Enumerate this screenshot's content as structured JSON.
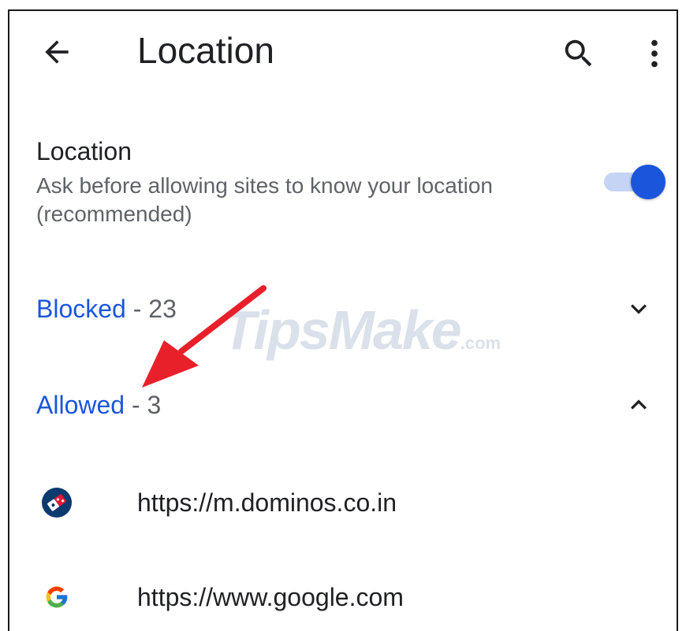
{
  "appbar": {
    "title": "Location",
    "back_icon": "arrow-left-icon",
    "search_icon": "search-icon",
    "more_icon": "more-vert-icon"
  },
  "setting": {
    "title": "Location",
    "description": "Ask before allowing sites to know your location (recommended)",
    "toggle_on": true,
    "accent": "#1a56db"
  },
  "sections": {
    "blocked": {
      "label": "Blocked",
      "count": " - 23",
      "chevron": "chevron-down-icon"
    },
    "allowed": {
      "label": "Allowed",
      "count": " - 3",
      "chevron": "chevron-up-icon"
    }
  },
  "sites": [
    {
      "url": "https://m.dominos.co.in",
      "icon": "dominos-favicon"
    },
    {
      "url": "https://www.google.com",
      "icon": "google-favicon"
    }
  ],
  "watermark": {
    "main": "TipsMake",
    "suffix": ".com"
  },
  "annotation": {
    "arrow_color": "#e8202a"
  }
}
